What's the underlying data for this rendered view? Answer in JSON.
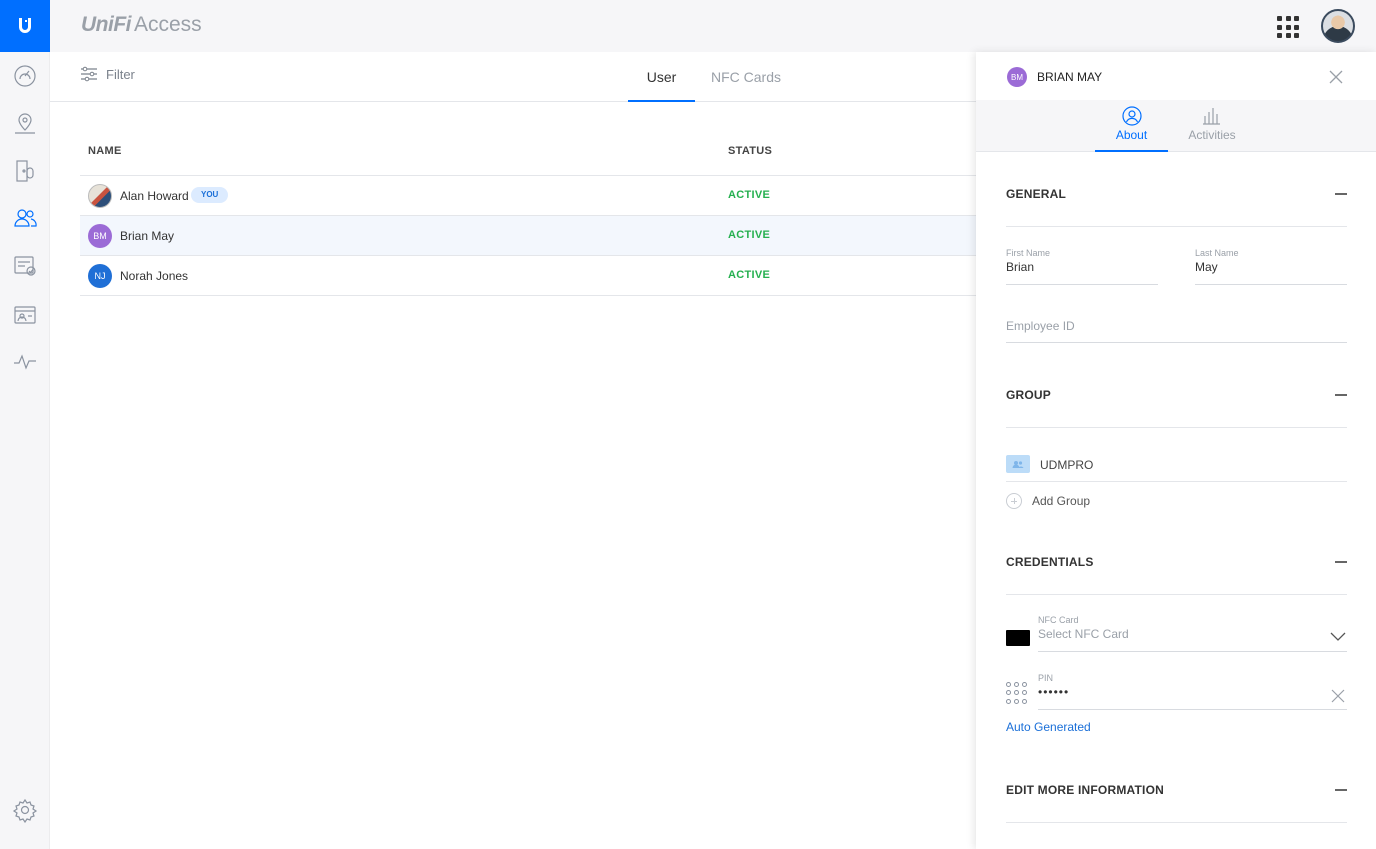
{
  "app": {
    "brand_unifi": "UniFi",
    "brand_access": "Access"
  },
  "toolbar": {
    "filter_label": "Filter",
    "tabs": [
      {
        "label": "User",
        "active": true
      },
      {
        "label": "NFC Cards",
        "active": false
      }
    ]
  },
  "table": {
    "columns": [
      "NAME",
      "STATUS"
    ],
    "rows": [
      {
        "initials": "",
        "name": "Alan Howard",
        "badge": "YOU",
        "status": "ACTIVE",
        "avatar_color": "#d9d2c6",
        "selected": false
      },
      {
        "initials": "BM",
        "name": "Brian May",
        "badge": "",
        "status": "ACTIVE",
        "avatar_color": "#9b6bd6",
        "selected": true
      },
      {
        "initials": "NJ",
        "name": "Norah Jones",
        "badge": "",
        "status": "ACTIVE",
        "avatar_color": "#1f6fd6",
        "selected": false
      }
    ]
  },
  "panel": {
    "initials": "BM",
    "title": "BRIAN MAY",
    "tabs": [
      {
        "label": "About",
        "active": true,
        "icon": "user-circle-icon"
      },
      {
        "label": "Activities",
        "active": false,
        "icon": "bar-chart-icon"
      }
    ],
    "general": {
      "title": "GENERAL",
      "first_name_label": "First Name",
      "first_name": "Brian",
      "last_name_label": "Last Name",
      "last_name": "May",
      "employee_id_placeholder": "Employee ID"
    },
    "group": {
      "title": "GROUP",
      "items": [
        "UDMPRO"
      ],
      "add_label": "Add Group"
    },
    "credentials": {
      "title": "CREDENTIALS",
      "nfc_label": "NFC Card",
      "nfc_placeholder": "Select NFC Card",
      "pin_label": "PIN",
      "pin_value": "••••••",
      "auto_generated": "Auto Generated"
    },
    "more": {
      "title": "EDIT MORE INFORMATION"
    }
  },
  "colors": {
    "accent": "#006fff",
    "active_status": "#26b050",
    "rail_bg": "#f6f6f8"
  }
}
